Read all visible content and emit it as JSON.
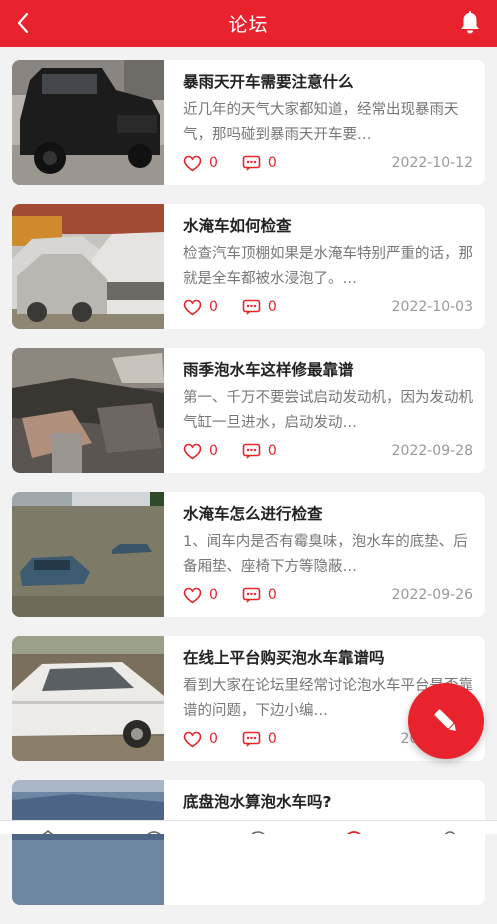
{
  "header": {
    "title": "论坛",
    "bg_color": "#e8232d",
    "back_icon": "chevron-left-icon",
    "bell_icon": "bell-icon"
  },
  "posts": [
    {
      "title": "暴雨天开车需要注意什么",
      "excerpt": "近几年的天气大家都知道，经常出现暴雨天气，那吗碰到暴雨天开车要…",
      "likes": "0",
      "comments": "0",
      "date": "2022-10-12",
      "image": "black-suv-photo"
    },
    {
      "title": "水淹车如何检查",
      "excerpt": "检查汽车顶棚如果是水淹车特别严重的话，那就是全车都被水浸泡了。…",
      "likes": "0",
      "comments": "0",
      "date": "2022-10-03",
      "image": "muddy-cars-photo"
    },
    {
      "title": "雨季泡水车这样修最靠谱",
      "excerpt": "第一、千万不要尝试启动发动机，因为发动机气缸一旦进水，启动发动…",
      "likes": "0",
      "comments": "0",
      "date": "2022-09-28",
      "image": "damaged-interior-photo"
    },
    {
      "title": "水淹车怎么进行检查",
      "excerpt": "1、闻车内是否有霉臭味，泡水车的底垫、后备厢垫、座椅下方等隐蔽…",
      "likes": "0",
      "comments": "0",
      "date": "2022-09-26",
      "image": "flooded-street-photo"
    },
    {
      "title": "在线上平台购买泡水车靠谱吗",
      "excerpt": "看到大家在论坛里经常讨论泡水车平台是否靠谱的问题，下边小编…",
      "likes": "0",
      "comments": "0",
      "date": "2022-09-2",
      "image": "white-car-flood-photo"
    },
    {
      "title": "底盘泡水算泡水车吗?",
      "excerpt": "",
      "likes": "",
      "comments": "",
      "date": "",
      "image": "car-underbody-photo"
    }
  ],
  "fab": {
    "icon": "pencil-icon"
  },
  "icons": {
    "like": "heart-icon",
    "comment": "comment-icon"
  },
  "colors": {
    "accent": "#e8232d",
    "date": "#999999",
    "excerpt": "#777777"
  }
}
